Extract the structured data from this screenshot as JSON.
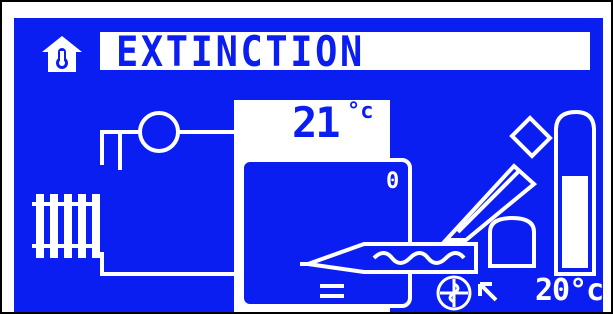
{
  "screen": {
    "title": "EXTINCTION",
    "room_temperature": "21",
    "room_temperature_unit": "°c",
    "boiler_value": "0",
    "outside_temperature": "20°c"
  },
  "icons": {
    "mode": "house-thermometer-icon",
    "radiator": "radiator-icon",
    "pump": "pump-icon",
    "fan": "fan-icon",
    "feeder": "screw-feeder-icon",
    "hopper": "fuel-hopper-icon",
    "outside": "outside-sensor-icon"
  },
  "colors": {
    "background": "#0b1ef2",
    "foreground": "#ffffff",
    "frame": "#000000"
  }
}
